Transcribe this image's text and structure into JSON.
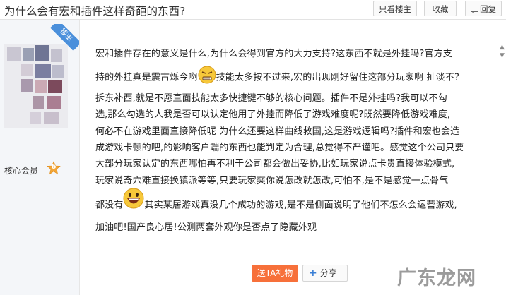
{
  "header": {
    "title": "为什么会有宏和插件这样奇葩的东西?",
    "only_louzhu_label": "只看楼主",
    "collect_label": "收藏",
    "reply_label": "回复"
  },
  "author": {
    "badge_label": "楼主",
    "member_label": "核心会员",
    "level": "6",
    "level_color": "#f3a637"
  },
  "post": {
    "line1": "宏和插件存在的意义是什么,为什么会得到官方的大力支持?这东西不就是外挂吗?官方支",
    "line2a": "持的外挂真是震古烁今啊",
    "line2b": "技能太多按不过来,宏的出现刚好留住这部分玩家啊 扯淡不?",
    "line3": "拆东补西,就是不愿直面技能太多快捷键不够的核心问题。插件不是外挂吗?我可以不勾",
    "line4": "选,那么勾选的人我是否可以认定他用了外挂而降低了游戏难度呢?既然要降低游戏难度,",
    "line5": "何必不在游戏里面直接降低呢 为什么还要这样曲线救国,这是游戏逻辑吗?插件和宏也会造",
    "line6": "成游戏卡顿的吧,的影响客户端的东西也能判定为合理,总觉得不严谨吧。感觉这个公司只要",
    "line7": "大部分玩家认定的东西哪怕再不利于公司都会做出妥协,比如玩家说点卡贵直接体验模式,",
    "line8": "玩家说奇穴难直接换镇派等等,只要玩家爽你说怎改就怎改,可怕不,是不是感觉一点骨气",
    "line9a": "都没有",
    "line9b": "其实某居游戏真没几个成功的游戏,是不是侧面说明了他们不怎么会运营游戏,",
    "line10": "加油吧!国产良心居!公测两套外观你是否点了隐藏外观",
    "emoji1": "angry-face-emoji",
    "emoji2": "grinning-face-emoji"
  },
  "actions": {
    "gift_label": "送TA礼物",
    "share_label": "分享",
    "gift_color": "#f7703a"
  },
  "watermark": {
    "text": "广东龙网"
  }
}
